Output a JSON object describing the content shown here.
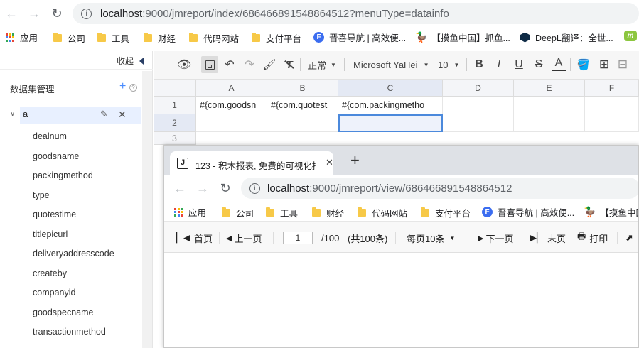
{
  "browser": {
    "url_host": "localhost",
    "url_path": ":9000/jmreport/index/686466891548864512?menuType=datainfo",
    "bookmarks": [
      "应用",
      "公司",
      "工具",
      "财经",
      "代码网站",
      "支付平台",
      "晋喜导航 | 高效便...",
      "【摸鱼中国】抓鱼...",
      "DeepL翻译：全世..."
    ],
    "bookmark_icons": [
      "apps-icon",
      "folder-icon",
      "folder-icon",
      "folder-icon",
      "folder-icon",
      "folder-icon",
      "f-circle-icon",
      "duck-icon",
      "deepl-icon"
    ]
  },
  "sidebar": {
    "collapse_label": "收起",
    "section_title": "数据集管理",
    "dataset_name": "a",
    "fields": [
      "dealnum",
      "goodsname",
      "packingmethod",
      "type",
      "quotestime",
      "titlepicurl",
      "deliveryaddresscode",
      "createby",
      "companyid",
      "goodspecname",
      "transactionmethod"
    ]
  },
  "toolbar": {
    "style_label": "正常",
    "font_label": "Microsoft YaHei",
    "size_label": "10"
  },
  "sheet": {
    "columns": [
      "A",
      "B",
      "C",
      "D",
      "E",
      "F"
    ],
    "rows": [
      "1",
      "2",
      "3"
    ],
    "row1": [
      "#{com.goodsn",
      "#{com.quotest",
      "#{com.packingmetho",
      "",
      "",
      ""
    ]
  },
  "popup": {
    "tab_favicon": "J",
    "tab_title": "123 - 积木报表, 免费的可视化报",
    "url_host": "localhost",
    "url_path": ":9000/jmreport/view/686466891548864512",
    "bookmarks": [
      "应用",
      "公司",
      "工具",
      "财经",
      "代码网站",
      "支付平台",
      "晋喜导航 | 高效便...",
      "【摸鱼中国"
    ],
    "first_page": "首页",
    "prev_page": "上一页",
    "page_value": "1",
    "total_pages": "/100",
    "total_count": "(共100条)",
    "page_size": "每页10条",
    "next_page": "下一页",
    "last_page": "末页",
    "print": "打印"
  }
}
